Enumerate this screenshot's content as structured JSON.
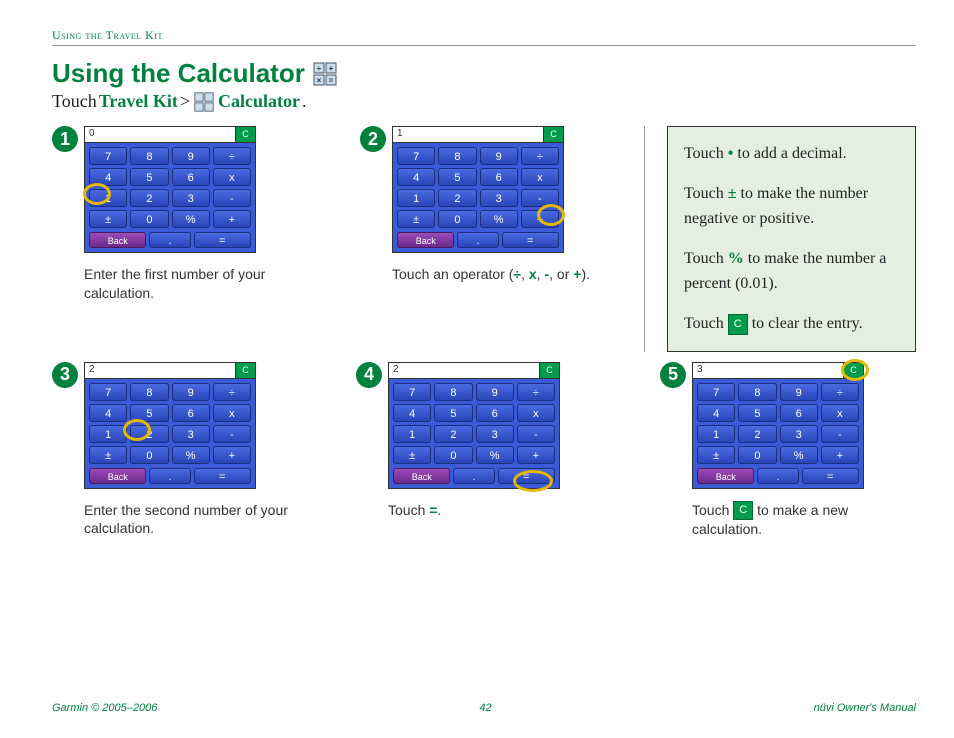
{
  "header": {
    "section": "Using the Travel Kit"
  },
  "title": "Using the Calculator",
  "subtitle": {
    "touch": "Touch ",
    "travel_kit": "Travel Kit",
    "gt": " > ",
    "calculator": "Calculator",
    "period": "."
  },
  "tips": {
    "decimal": {
      "pre": "Touch ",
      "sym": "•",
      "post": " to add a decimal."
    },
    "plusminus": {
      "pre": "Touch ",
      "sym": "±",
      "post": " to make the number negative or positive."
    },
    "percent": {
      "pre": "Touch ",
      "sym": "%",
      "post": " to make the number a percent (0.01)."
    },
    "clear": {
      "pre": "Touch ",
      "btn": "C",
      "post": " to clear the entry."
    }
  },
  "calc": {
    "clear": "C",
    "back": "Back",
    "keys": [
      "7",
      "8",
      "9",
      "÷",
      "4",
      "5",
      "6",
      "x",
      "1",
      "2",
      "3",
      "-",
      "±",
      "0",
      "%",
      "+"
    ],
    "bot_dot": ".",
    "bot_eq": "="
  },
  "steps": {
    "s1": {
      "num": "1",
      "display": "0",
      "caption": "Enter the first number of your calculation."
    },
    "s2": {
      "num": "2",
      "display": "1",
      "caption_pre": "Touch an operator (",
      "ops": [
        "÷",
        "x",
        "-",
        "+"
      ],
      "caption_post": ")."
    },
    "s3": {
      "num": "3",
      "display": "2",
      "caption": "Enter the second number of your calculation."
    },
    "s4": {
      "num": "4",
      "display": "2",
      "caption_pre": "Touch ",
      "sym": "=",
      "caption_post": "."
    },
    "s5": {
      "num": "5",
      "display": "3",
      "caption_pre": "Touch ",
      "btn": "C",
      "caption_post": " to make a new calculation."
    }
  },
  "footer": {
    "left": "Garmin © 2005–2006",
    "center": "42",
    "right": "nüvi Owner's Manual"
  }
}
